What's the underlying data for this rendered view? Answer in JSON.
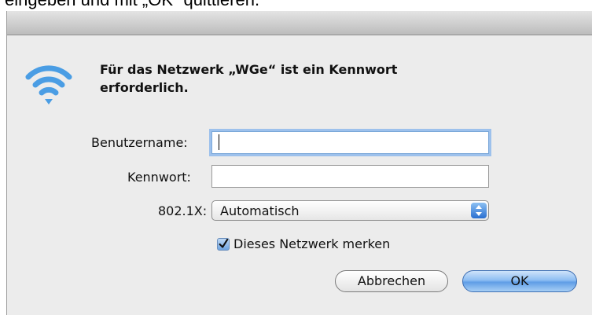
{
  "intro": {
    "text": "eingeben und mit „OK“ quittieren."
  },
  "dialog": {
    "message_line1": "Für das Netzwerk „WGe“ ist ein Kennwort",
    "message_line2": "erforderlich.",
    "icon": "wifi-icon",
    "fields": {
      "username_label": "Benutzername:",
      "username_value": "",
      "password_label": "Kennwort:",
      "password_value": "",
      "dot1x_label": "802.1X:",
      "dot1x_value": "Automatisch"
    },
    "remember": {
      "label": "Dieses Netzwerk merken",
      "checked": true
    },
    "buttons": {
      "cancel": "Abbrechen",
      "ok": "OK"
    }
  },
  "colors": {
    "dialog_bg": "#ececec",
    "focus_ring": "#9dc1ec",
    "wifi_blue": "#4a9de4",
    "default_button": "#5f9de6"
  }
}
